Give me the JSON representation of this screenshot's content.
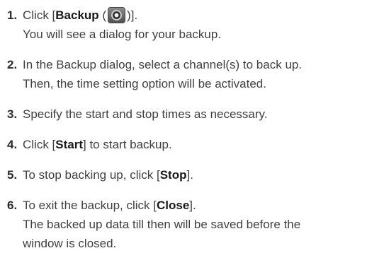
{
  "steps": [
    {
      "num": "1.",
      "line1_pre": "Click [",
      "line1_kw": "Backup",
      "line1_mid": " (",
      "line1_post": ")].",
      "line2": "You will see a dialog for your backup.",
      "icon": "backup-disc-icon"
    },
    {
      "num": "2.",
      "line1": "In the Backup dialog, select a channel(s) to back up.",
      "line2": "Then, the time setting option will be activated."
    },
    {
      "num": "3.",
      "line1": "Specify the start and stop times as necessary."
    },
    {
      "num": "4.",
      "pre": "Click [",
      "kw": "Start",
      "post": "] to start backup."
    },
    {
      "num": "5.",
      "pre": "To stop backing up, click [",
      "kw": "Stop",
      "post": "]."
    },
    {
      "num": "6.",
      "pre": "To exit the backup, click [",
      "kw": "Close",
      "post": "].",
      "line2": "The backed up data till then will be saved before the",
      "line3": "window is closed."
    }
  ]
}
